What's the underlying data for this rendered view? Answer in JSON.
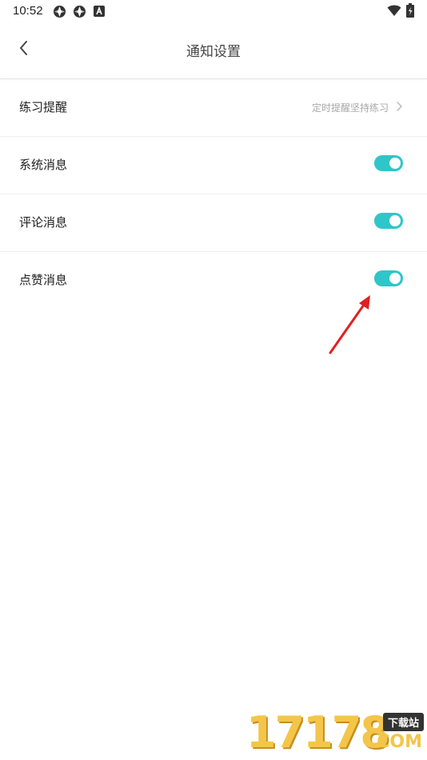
{
  "status_bar": {
    "time": "10:52"
  },
  "header": {
    "title": "通知设置"
  },
  "settings": [
    {
      "label": "练习提醒",
      "value": "定时提醒坚持练习"
    },
    {
      "label": "系统消息",
      "toggle_on": true
    },
    {
      "label": "评论消息",
      "toggle_on": true
    },
    {
      "label": "点赞消息",
      "toggle_on": true
    }
  ],
  "colors": {
    "toggle_on": "#2ec6c8",
    "arrow": "#e02020"
  },
  "watermark": {
    "number": "17178",
    "badge": "下载站",
    "suffix": ".COM"
  }
}
